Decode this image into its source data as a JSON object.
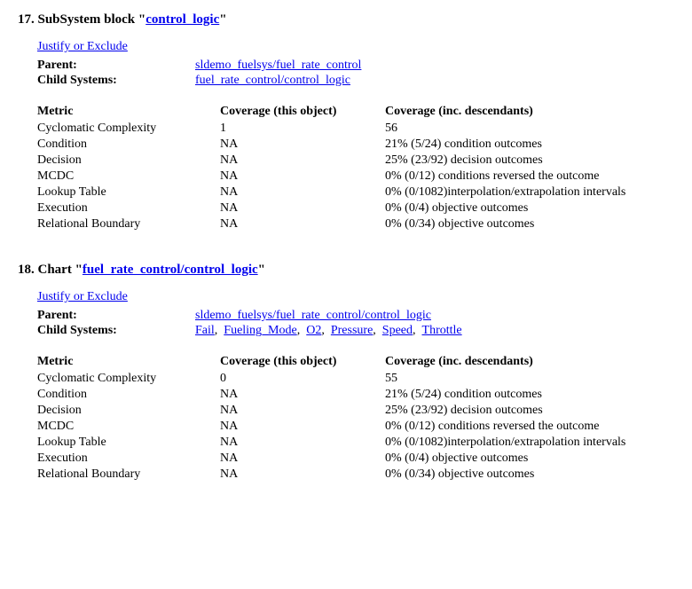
{
  "sections": [
    {
      "number": "17.",
      "type_label": "SubSystem block",
      "title_link": "control_logic",
      "justify_label": "Justify or Exclude",
      "parent_label": "Parent:",
      "parent_link": "sldemo_fuelsys/fuel_rate_control",
      "child_label": "Child Systems:",
      "child_links": [
        "fuel_rate_control/control_logic"
      ],
      "headers": {
        "metric": "Metric",
        "this": "Coverage (this object)",
        "desc": "Coverage (inc. descendants)"
      },
      "rows": [
        {
          "metric": "Cyclomatic Complexity",
          "this": "1",
          "desc": "56"
        },
        {
          "metric": "Condition",
          "this": "NA",
          "desc": "21% (5/24) condition outcomes"
        },
        {
          "metric": "Decision",
          "this": "NA",
          "desc": "25% (23/92) decision outcomes"
        },
        {
          "metric": "MCDC",
          "this": "NA",
          "desc": "0% (0/12) conditions reversed the outcome"
        },
        {
          "metric": "Lookup Table",
          "this": "NA",
          "desc": "0% (0/1082)interpolation/extrapolation intervals"
        },
        {
          "metric": "Execution",
          "this": "NA",
          "desc": "0% (0/4) objective outcomes"
        },
        {
          "metric": "Relational Boundary",
          "this": "NA",
          "desc": "0% (0/34) objective outcomes"
        }
      ]
    },
    {
      "number": "18.",
      "type_label": "Chart",
      "title_link": "fuel_rate_control/control_logic",
      "justify_label": "Justify or Exclude",
      "parent_label": "Parent:",
      "parent_link": "sldemo_fuelsys/fuel_rate_control/control_logic",
      "child_label": "Child Systems:",
      "child_links": [
        "Fail",
        "Fueling_Mode",
        "O2",
        "Pressure",
        "Speed",
        "Throttle"
      ],
      "headers": {
        "metric": "Metric",
        "this": "Coverage (this object)",
        "desc": "Coverage (inc. descendants)"
      },
      "rows": [
        {
          "metric": "Cyclomatic Complexity",
          "this": "0",
          "desc": "55"
        },
        {
          "metric": "Condition",
          "this": "NA",
          "desc": "21% (5/24) condition outcomes"
        },
        {
          "metric": "Decision",
          "this": "NA",
          "desc": "25% (23/92) decision outcomes"
        },
        {
          "metric": "MCDC",
          "this": "NA",
          "desc": "0% (0/12) conditions reversed the outcome"
        },
        {
          "metric": "Lookup Table",
          "this": "NA",
          "desc": "0% (0/1082)interpolation/extrapolation intervals"
        },
        {
          "metric": "Execution",
          "this": "NA",
          "desc": "0% (0/4) objective outcomes"
        },
        {
          "metric": "Relational Boundary",
          "this": "NA",
          "desc": "0% (0/34) objective outcomes"
        }
      ]
    }
  ]
}
